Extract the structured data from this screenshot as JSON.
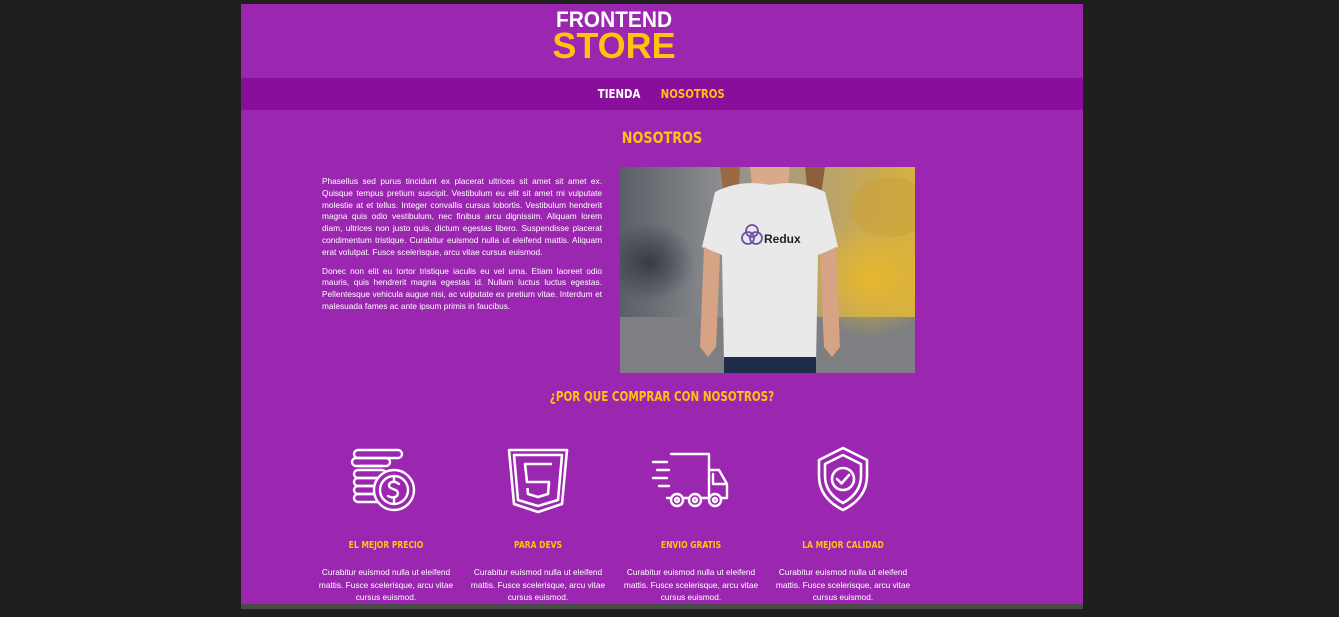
{
  "logo": {
    "line1": "FRONTEND",
    "line2": "STORE"
  },
  "nav": {
    "items": [
      {
        "label": "TIENDA",
        "active": false
      },
      {
        "label": "NOSOTROS",
        "active": true
      }
    ]
  },
  "about": {
    "title": "NOSOTROS",
    "paragraphs": [
      "Phasellus sed purus tincidunt ex placerat ultrices sit amet sit amet ex. Quisque tempus pretium suscipit. Vestibulum eu elit sit amet mi vulputate molestie at et tellus. Integer convallis cursus lobortis. Vestibulum hendrerit magna quis odio vestibulum, nec finibus arcu dignissim. Aliquam lorem diam, ultrices non justo quis, dictum egestas libero. Suspendisse placerat condimentum tristique. Curabitur euismod nulla ut eleifend mattis. Aliquam erat volutpat. Fusce scelerisque, arcu vitae cursus euismod.",
      "Donec non elit eu tortor tristique iaculis eu vel urna. Etiam laoreet odio mauris, quis hendrerit magna egestas id. Nullam luctus luctus egestas. Pellentesque vehicula augue nisi, ac vulputate ex pretium vitae. Interdum et malesuada fames ac ante ipsum primis in faucibus."
    ],
    "photo_shirt_text": "Redux"
  },
  "why": {
    "title": "¿POR QUE COMPRAR CON NOSOTROS?",
    "features": [
      {
        "icon": "coins-dollar-icon",
        "title": "EL MEJOR PRECIO",
        "desc": "Curabitur euismod nulla ut eleifend mattis. Fusce scelerisque, arcu vitae cursus euismod."
      },
      {
        "icon": "html5-icon",
        "title": "PARA DEVS",
        "desc": "Curabitur euismod nulla ut eleifend mattis. Fusce scelerisque, arcu vitae cursus euismod."
      },
      {
        "icon": "delivery-truck-icon",
        "title": "ENVIO GRATIS",
        "desc": "Curabitur euismod nulla ut eleifend mattis. Fusce scelerisque, arcu vitae cursus euismod."
      },
      {
        "icon": "shield-check-icon",
        "title": "LA MEJOR CALIDAD",
        "desc": "Curabitur euismod nulla ut eleifend mattis. Fusce scelerisque, arcu vitae cursus euismod."
      }
    ]
  },
  "colors": {
    "page_bg": "#9b27b0",
    "nav_bg": "#880e9b",
    "accent": "#ffc20e",
    "text": "#ffffff",
    "outer_bg": "#1f1f1f"
  }
}
